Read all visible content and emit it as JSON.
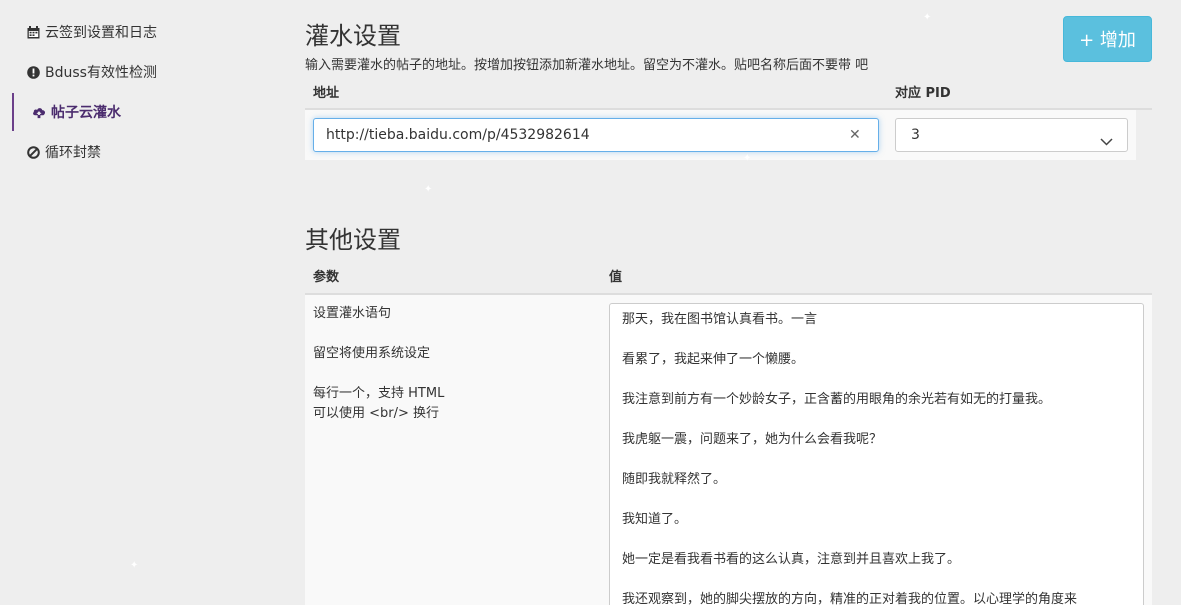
{
  "sidebar": {
    "items": [
      {
        "label": "云签到设置和日志",
        "icon": "calendar-icon"
      },
      {
        "label": "Bduss有效性检测",
        "icon": "exclamation-circle-icon"
      },
      {
        "label": "帖子云灌水",
        "icon": "cloud-upload-icon",
        "active": true
      },
      {
        "label": "循环封禁",
        "icon": "ban-icon"
      }
    ]
  },
  "water": {
    "title": "灌水设置",
    "add_label": "+ 增加",
    "description": "输入需要灌水的帖子的地址。按增加按钮添加新灌水地址。留空为不灌水。贴吧名称后面不要带 吧",
    "col_url": "地址",
    "col_pid": "对应 PID",
    "url_value": "http://tieba.baidu.com/p/4532982614",
    "pid_value": "3"
  },
  "other": {
    "title": "其他设置",
    "col_param": "参数",
    "col_value": "值",
    "param_name": "设置灌水语句",
    "param_hint1": "留空将使用系统设定",
    "param_hint2": "每行一个，支持 HTML",
    "param_hint3": "可以使用 <br/> 换行",
    "lines": [
      "那天，我在图书馆认真看书。一言",
      "看累了，我起来伸了一个懒腰。",
      "我注意到前方有一个妙龄女子，正含蓄的用眼角的余光若有如无的打量我。",
      "我虎躯一震，问题来了，她为什么会看我呢？",
      "随即我就释然了。",
      "我知道了。",
      "她一定是看我看书看的这么认真，注意到并且喜欢上我了。",
      "我还观察到，她的脚尖摆放的方向，精准的正对着我的位置。以心理学的角度来"
    ]
  },
  "colors": {
    "accent": "#5bc0de",
    "active_nav": "#4b2c6e",
    "focus_border": "#66afe9"
  }
}
